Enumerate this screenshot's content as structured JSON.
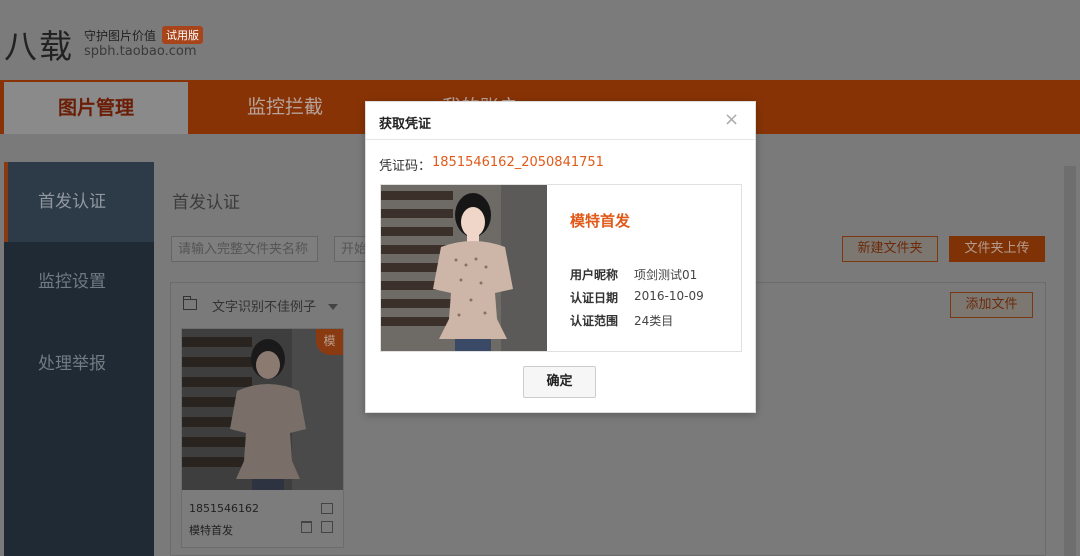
{
  "header": {
    "logo": "八载",
    "tagline": "守护图片价值",
    "badge": "试用版",
    "url": "spbh.taobao.com"
  },
  "nav": {
    "tabs": [
      {
        "label": "图片管理",
        "active": true
      },
      {
        "label": "监控拦截",
        "active": false
      },
      {
        "label": "我的账户",
        "active": false
      }
    ]
  },
  "sidebar": {
    "items": [
      {
        "label": "首发认证",
        "active": true
      },
      {
        "label": "监控设置",
        "active": false
      },
      {
        "label": "处理举报",
        "active": false
      }
    ]
  },
  "main": {
    "title": "首发认证",
    "search_placeholder": "请输入完整文件夹名称",
    "date_placeholder": "开始",
    "new_folder_label": "新建文件夹",
    "upload_folder_label": "文件夹上传",
    "folder_name": "文字识别不佳例子",
    "add_file_label": "添加文件"
  },
  "card": {
    "badge": "模",
    "code": "1851546162",
    "name": "模特首发"
  },
  "dialog": {
    "title": "获取凭证",
    "close_symbol": "×",
    "cert_label": "凭证码：",
    "cert_code": "1851546162_2050841751",
    "model_title": "模特首发",
    "rows": [
      {
        "label": "用户昵称",
        "value": "项剑测试01"
      },
      {
        "label": "认证日期",
        "value": "2016-10-09"
      },
      {
        "label": "认证范围",
        "value": "24类目"
      }
    ],
    "ok_label": "确定"
  },
  "colors": {
    "accent": "#e05a1a",
    "nav_bg": "#883306",
    "sidebar_bg": "#1f2a34"
  }
}
